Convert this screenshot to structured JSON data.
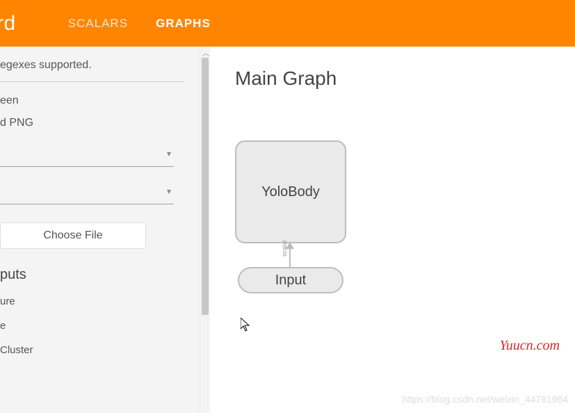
{
  "header": {
    "logo_fragment": "rd",
    "tabs": [
      {
        "label": "SCALARS",
        "active": false
      },
      {
        "label": "GRAPHS",
        "active": true
      }
    ]
  },
  "sidebar": {
    "regex_hint": "egexes supported.",
    "fit_screen": "een",
    "download_png": "d PNG",
    "choose_file": "Choose File",
    "section_subgraph": "puts",
    "check_items": [
      "ure",
      "e",
      "Cluster"
    ]
  },
  "main": {
    "title": "Main Graph",
    "nodes": {
      "yolobody": "YoloBody",
      "input": "Input",
      "edge_label": "scalar"
    }
  },
  "watermarks": {
    "site": "Yuucn.com",
    "blog": "https://blog.csdn.net/weixin_44791964"
  }
}
